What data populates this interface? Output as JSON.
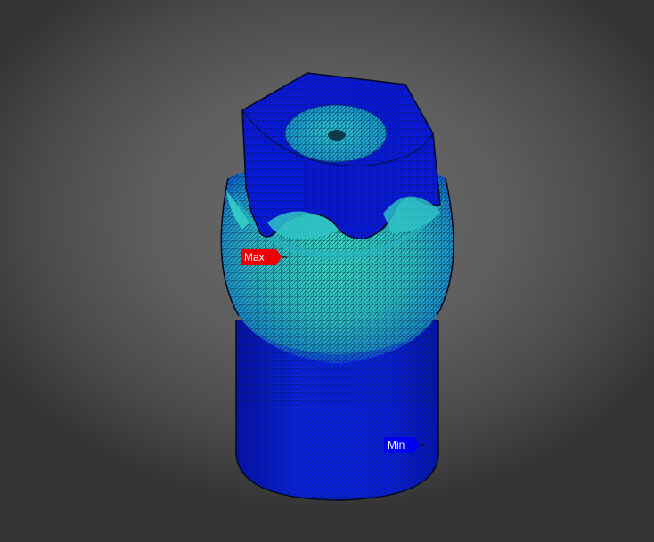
{
  "colors": {
    "background": "#5e5e5e",
    "stress_low": "#0a1ee0",
    "stress_mid": "#1aa6c8",
    "stress_high": "#3ad0c0",
    "max_marker": "#ee0000",
    "min_marker": "#0000ee"
  },
  "markers": {
    "max_label": "Max",
    "min_label": "Min"
  },
  "icons": {
    "max_marker": "max-probe-flag-icon",
    "min_marker": "min-probe-flag-icon"
  }
}
